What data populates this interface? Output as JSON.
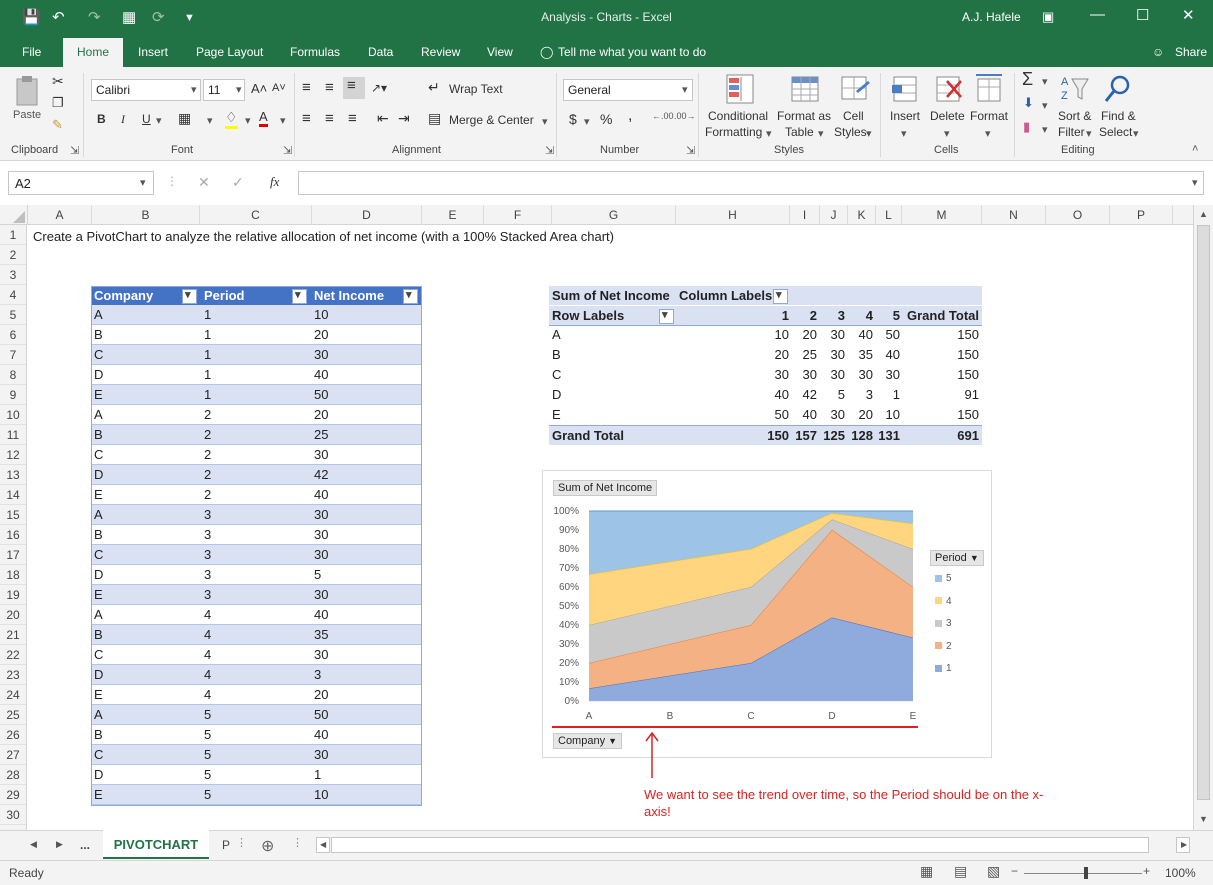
{
  "titlebar": {
    "title": "Analysis - Charts  -  Excel",
    "user": "A.J. Hafele",
    "qat_icons": [
      "save-icon",
      "undo-icon",
      "redo-icon",
      "form-icon",
      "refresh-icon",
      "customize-icon"
    ]
  },
  "tabs": [
    "File",
    "Home",
    "Insert",
    "Page Layout",
    "Formulas",
    "Data",
    "Review",
    "View"
  ],
  "active_tab": "Home",
  "tell_me": "Tell me what you want to do",
  "share": "Share",
  "ribbon": {
    "clipboard": {
      "label": "Clipboard",
      "paste": "Paste"
    },
    "font": {
      "label": "Font",
      "name": "Calibri",
      "size": "11",
      "bold": "B",
      "italic": "I",
      "underline": "U"
    },
    "alignment": {
      "label": "Alignment",
      "wrap": "Wrap Text",
      "merge": "Merge & Center"
    },
    "number": {
      "label": "Number",
      "format": "General",
      "currency": "$",
      "percent": "%",
      "comma": ","
    },
    "styles": {
      "label": "Styles",
      "conditional1": "Conditional",
      "conditional2": "Formatting",
      "table1": "Format as",
      "table2": "Table",
      "cell1": "Cell",
      "cell2": "Styles"
    },
    "cells": {
      "label": "Cells",
      "insert": "Insert",
      "delete": "Delete",
      "format": "Format"
    },
    "editing": {
      "label": "Editing",
      "sort1": "Sort &",
      "sort2": "Filter",
      "find1": "Find &",
      "find2": "Select"
    }
  },
  "formula_bar": {
    "name_box": "A2",
    "fx": "fx",
    "content": ""
  },
  "columns": [
    "A",
    "B",
    "C",
    "D",
    "E",
    "F",
    "G",
    "H",
    "I",
    "J",
    "K",
    "L",
    "M",
    "N",
    "O",
    "P"
  ],
  "rows": [
    "1",
    "2",
    "3",
    "4",
    "5",
    "6",
    "7",
    "8",
    "9",
    "10",
    "11",
    "12",
    "13",
    "14",
    "15",
    "16",
    "17",
    "18",
    "19",
    "20",
    "21",
    "22",
    "23",
    "24",
    "25",
    "26",
    "27",
    "28",
    "29",
    "30"
  ],
  "instruction": "Create a PivotChart to analyze the relative allocation of net income (with a 100% Stacked Area chart)",
  "table": {
    "headers": [
      "Company",
      "Period",
      "Net Income"
    ],
    "rows": [
      [
        "A",
        "1",
        "10"
      ],
      [
        "B",
        "1",
        "20"
      ],
      [
        "C",
        "1",
        "30"
      ],
      [
        "D",
        "1",
        "40"
      ],
      [
        "E",
        "1",
        "50"
      ],
      [
        "A",
        "2",
        "20"
      ],
      [
        "B",
        "2",
        "25"
      ],
      [
        "C",
        "2",
        "30"
      ],
      [
        "D",
        "2",
        "42"
      ],
      [
        "E",
        "2",
        "40"
      ],
      [
        "A",
        "3",
        "30"
      ],
      [
        "B",
        "3",
        "30"
      ],
      [
        "C",
        "3",
        "30"
      ],
      [
        "D",
        "3",
        "5"
      ],
      [
        "E",
        "3",
        "30"
      ],
      [
        "A",
        "4",
        "40"
      ],
      [
        "B",
        "4",
        "35"
      ],
      [
        "C",
        "4",
        "30"
      ],
      [
        "D",
        "4",
        "3"
      ],
      [
        "E",
        "4",
        "20"
      ],
      [
        "A",
        "5",
        "50"
      ],
      [
        "B",
        "5",
        "40"
      ],
      [
        "C",
        "5",
        "30"
      ],
      [
        "D",
        "5",
        "1"
      ],
      [
        "E",
        "5",
        "10"
      ]
    ]
  },
  "pivot": {
    "corner": "Sum of Net Income",
    "column_labels": "Column Labels",
    "row_labels": "Row Labels",
    "periods": [
      "1",
      "2",
      "3",
      "4",
      "5"
    ],
    "grand_total_label": "Grand Total",
    "rows": [
      {
        "label": "A",
        "values": [
          "10",
          "20",
          "30",
          "40",
          "50"
        ],
        "total": "150"
      },
      {
        "label": "B",
        "values": [
          "20",
          "25",
          "30",
          "35",
          "40"
        ],
        "total": "150"
      },
      {
        "label": "C",
        "values": [
          "30",
          "30",
          "30",
          "30",
          "30"
        ],
        "total": "150"
      },
      {
        "label": "D",
        "values": [
          "40",
          "42",
          "5",
          "3",
          "1"
        ],
        "total": "91"
      },
      {
        "label": "E",
        "values": [
          "50",
          "40",
          "30",
          "20",
          "10"
        ],
        "total": "150"
      }
    ],
    "grand_totals": [
      "150",
      "157",
      "125",
      "128",
      "131"
    ],
    "grand_total": "691"
  },
  "chart_data": {
    "type": "area",
    "stacked": "100%",
    "title": "",
    "value_field_button": "Sum of Net Income",
    "axis_field_button": "Company",
    "legend_title": "Period",
    "legend_position": "right",
    "categories": [
      "A",
      "B",
      "C",
      "D",
      "E"
    ],
    "y_ticks": [
      "0%",
      "10%",
      "20%",
      "30%",
      "40%",
      "50%",
      "60%",
      "70%",
      "80%",
      "90%",
      "100%"
    ],
    "ylim": [
      0,
      100
    ],
    "series": [
      {
        "name": "1",
        "values": [
          10,
          20,
          30,
          40,
          50
        ],
        "color": "#8faadc"
      },
      {
        "name": "2",
        "values": [
          20,
          25,
          30,
          42,
          40
        ],
        "color": "#f4b183"
      },
      {
        "name": "3",
        "values": [
          30,
          30,
          30,
          5,
          30
        ],
        "color": "#c9c9c9"
      },
      {
        "name": "4",
        "values": [
          40,
          35,
          30,
          3,
          20
        ],
        "color": "#ffd67f"
      },
      {
        "name": "5",
        "values": [
          50,
          40,
          30,
          1,
          10
        ],
        "color": "#9dc3e6"
      }
    ]
  },
  "annotation": "We want to see the trend over time, so the Period should be on the x-axis!",
  "sheet_tabs": {
    "ellipsis": "...",
    "active": "PIVOTCHART",
    "next": "P"
  },
  "status": {
    "ready": "Ready",
    "zoom": "100%",
    "minus": "−",
    "plus": "+"
  }
}
